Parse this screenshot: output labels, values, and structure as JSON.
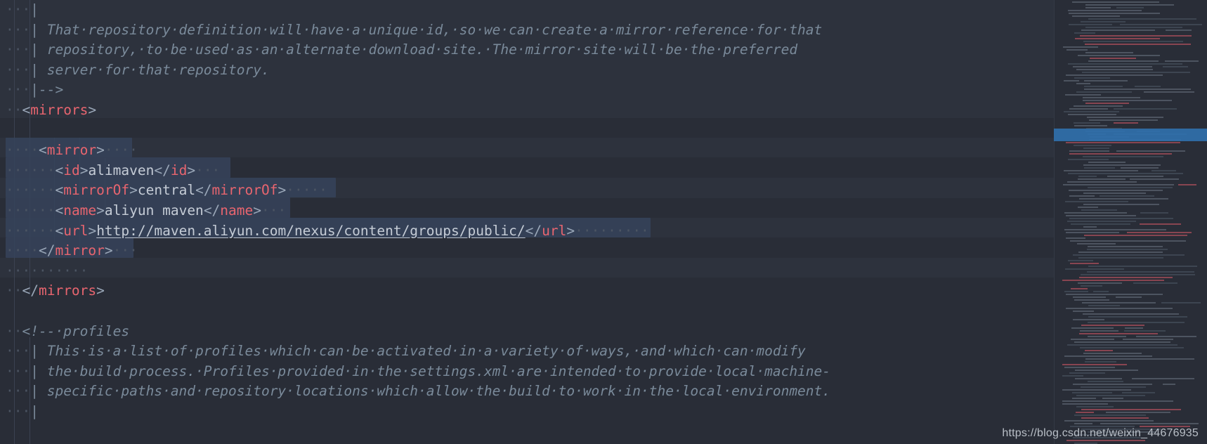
{
  "app": {
    "kind": "code-editor",
    "theme": "dark",
    "language": "xml",
    "file_hint": "settings.xml"
  },
  "colors": {
    "background": "#292d37",
    "tag": "#e8656f",
    "bracket": "#9aa7b8",
    "text": "#c5ccd6",
    "comment": "#7a8a9a",
    "whitespace_dot": "#4c5563",
    "selection": "#36435a",
    "indent_guide": "#3b4252",
    "minimap_viewport": "#2f6ea8"
  },
  "editor": {
    "lines": [
      {
        "id": "l1",
        "indent": 3,
        "segments": [
          {
            "t": "cmt",
            "v": "|"
          }
        ]
      },
      {
        "id": "l2",
        "indent": 3,
        "segments": [
          {
            "t": "cmt",
            "v": "| That·repository·definition·will·have·a·unique·id,·so·we·can·create·a·mirror·reference·for·that"
          }
        ]
      },
      {
        "id": "l3",
        "indent": 3,
        "segments": [
          {
            "t": "cmt",
            "v": "| repository,·to·be·used·as·an·alternate·download·site.·The·mirror·site·will·be·the·preferred"
          }
        ]
      },
      {
        "id": "l4",
        "indent": 3,
        "segments": [
          {
            "t": "cmt",
            "v": "| server·for·that·repository."
          }
        ]
      },
      {
        "id": "l5",
        "indent": 3,
        "segments": [
          {
            "t": "cmt",
            "v": "|-->"
          }
        ]
      },
      {
        "id": "l6",
        "indent": 2,
        "segments": [
          {
            "t": "brk",
            "v": "<"
          },
          {
            "t": "tag",
            "v": "mirrors"
          },
          {
            "t": "brk",
            "v": ">"
          }
        ]
      },
      {
        "id": "l7",
        "indent": 0,
        "segments": []
      },
      {
        "id": "l8",
        "indent": 4,
        "segments": [
          {
            "t": "brk",
            "v": "<"
          },
          {
            "t": "tag",
            "v": "mirror"
          },
          {
            "t": "brk",
            "v": ">"
          }
        ]
      },
      {
        "id": "l9",
        "indent": 6,
        "segments": [
          {
            "t": "brk",
            "v": "<"
          },
          {
            "t": "tag",
            "v": "id"
          },
          {
            "t": "brk",
            "v": ">"
          },
          {
            "t": "txt",
            "v": "alimaven"
          },
          {
            "t": "brk",
            "v": "</"
          },
          {
            "t": "tag",
            "v": "id"
          },
          {
            "t": "brk",
            "v": ">"
          }
        ]
      },
      {
        "id": "l10",
        "indent": 6,
        "segments": [
          {
            "t": "brk",
            "v": "<"
          },
          {
            "t": "tag",
            "v": "mirrorOf"
          },
          {
            "t": "brk",
            "v": ">"
          },
          {
            "t": "txt",
            "v": "central"
          },
          {
            "t": "brk",
            "v": "</"
          },
          {
            "t": "tag",
            "v": "mirrorOf"
          },
          {
            "t": "brk",
            "v": ">"
          }
        ]
      },
      {
        "id": "l11",
        "indent": 6,
        "segments": [
          {
            "t": "brk",
            "v": "<"
          },
          {
            "t": "tag",
            "v": "name"
          },
          {
            "t": "brk",
            "v": ">"
          },
          {
            "t": "txt",
            "v": "aliyun maven"
          },
          {
            "t": "brk",
            "v": "</"
          },
          {
            "t": "tag",
            "v": "name"
          },
          {
            "t": "brk",
            "v": ">"
          }
        ]
      },
      {
        "id": "l12",
        "indent": 6,
        "segments": [
          {
            "t": "brk",
            "v": "<"
          },
          {
            "t": "tag",
            "v": "url"
          },
          {
            "t": "brk",
            "v": ">"
          },
          {
            "t": "link",
            "v": "http://maven.aliyun.com/nexus/content/groups/public/"
          },
          {
            "t": "brk",
            "v": "</"
          },
          {
            "t": "tag",
            "v": "url"
          },
          {
            "t": "brk",
            "v": ">"
          }
        ]
      },
      {
        "id": "l13",
        "indent": 4,
        "segments": [
          {
            "t": "brk",
            "v": "</"
          },
          {
            "t": "tag",
            "v": "mirror"
          },
          {
            "t": "brk",
            "v": ">"
          }
        ]
      },
      {
        "id": "l14",
        "indent": 5,
        "segments": []
      },
      {
        "id": "l15",
        "indent": 2,
        "segments": [
          {
            "t": "brk",
            "v": "</"
          },
          {
            "t": "tag",
            "v": "mirrors"
          },
          {
            "t": "brk",
            "v": ">"
          }
        ]
      },
      {
        "id": "l16",
        "indent": 0,
        "segments": []
      },
      {
        "id": "l17",
        "indent": 2,
        "segments": [
          {
            "t": "cmt",
            "v": "<!--·profiles"
          }
        ]
      },
      {
        "id": "l18",
        "indent": 3,
        "segments": [
          {
            "t": "cmt",
            "v": "| This·is·a·list·of·profiles·which·can·be·activated·in·a·variety·of·ways,·and·which·can·modify"
          }
        ]
      },
      {
        "id": "l19",
        "indent": 3,
        "segments": [
          {
            "t": "cmt",
            "v": "| the·build·process.·Profiles·provided·in·the·settings.xml·are·intended·to·provide·local·machine-"
          }
        ]
      },
      {
        "id": "l20",
        "indent": 3,
        "segments": [
          {
            "t": "cmt",
            "v": "| specific·paths·and·repository·locations·which·allow·the·build·to·work·in·the·local·environment."
          }
        ]
      },
      {
        "id": "l21",
        "indent": 3,
        "segments": [
          {
            "t": "cmt",
            "v": "|"
          }
        ]
      }
    ],
    "selection_note": "block selection spanning the <mirror> element lines",
    "mirror_values": {
      "id": "alimaven",
      "mirrorOf": "central",
      "name": "aliyun maven",
      "url": "http://maven.aliyun.com/nexus/content/groups/public/"
    }
  },
  "minimap": {
    "label": "code-minimap",
    "viewport_highlight": true
  },
  "watermark": {
    "text": "https://blog.csdn.net/weixin_44676935"
  }
}
